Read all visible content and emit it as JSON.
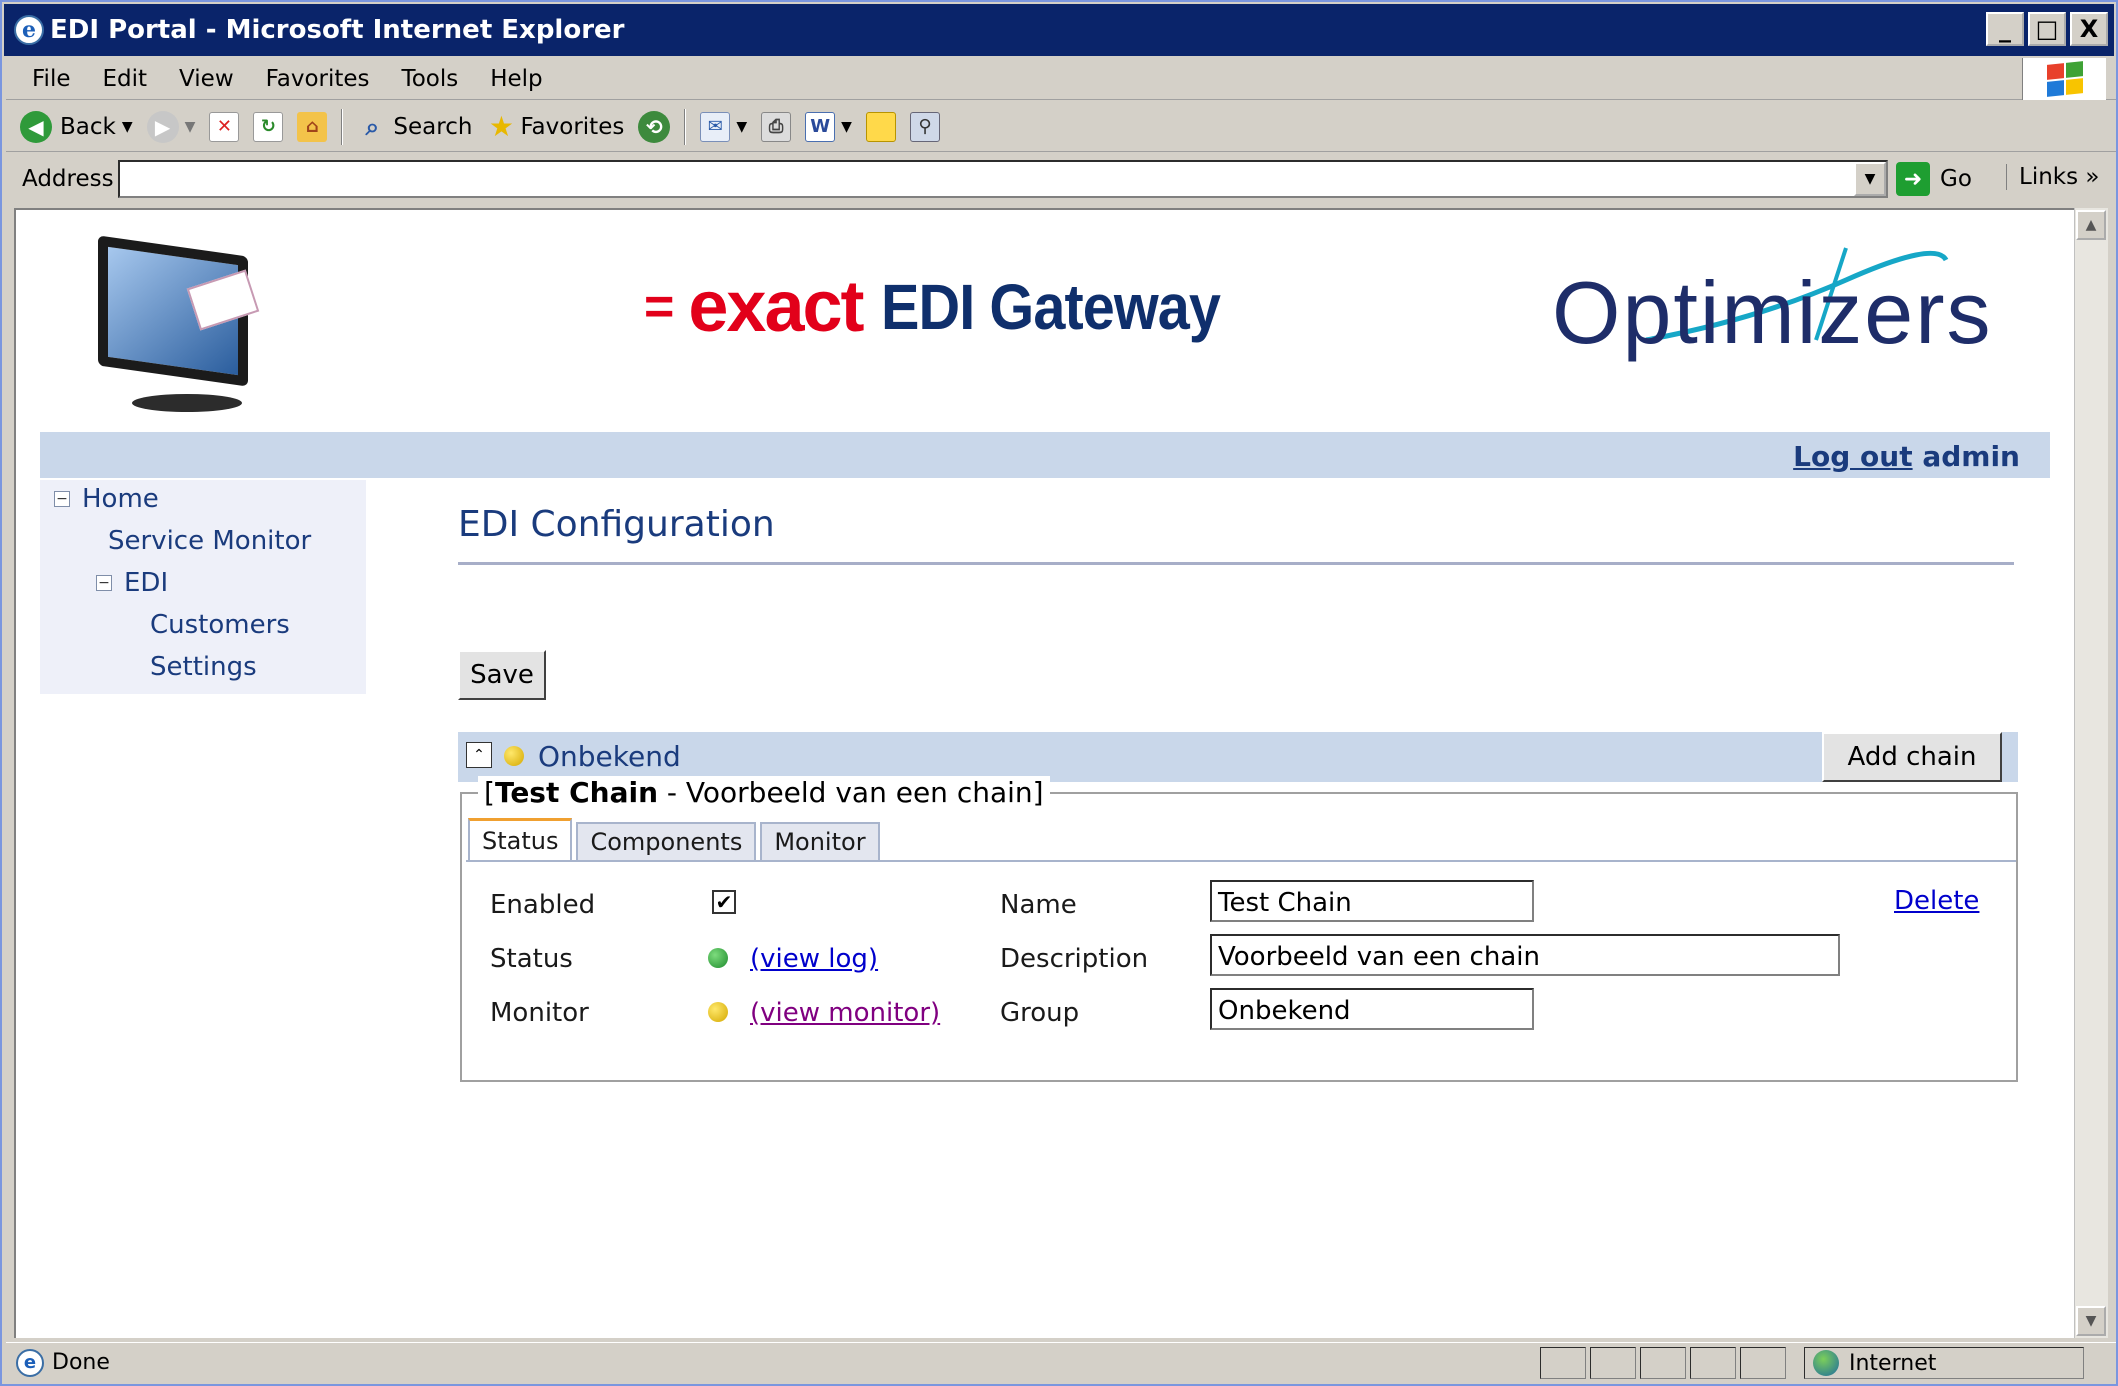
{
  "window": {
    "title": "EDI Portal - Microsoft Internet Explorer",
    "buttons": [
      "_",
      "□",
      "X"
    ]
  },
  "menu": [
    "File",
    "Edit",
    "View",
    "Favorites",
    "Tools",
    "Help"
  ],
  "toolbar": {
    "back_label": "Back",
    "search_label": "Search",
    "favorites_label": "Favorites"
  },
  "address": {
    "label": "Address",
    "value": "",
    "go_label": "Go",
    "links_label": "Links"
  },
  "page": {
    "logo_exact": "exact",
    "logo_equals": "=",
    "logo_gateway": "EDI Gateway",
    "logo_optimizers": "Optimizers",
    "logout_link": "Log out",
    "logout_user": "admin",
    "nav": {
      "home": "Home",
      "service_monitor": "Service Monitor",
      "edi": "EDI",
      "customers": "Customers",
      "settings": "Settings"
    },
    "heading": "EDI Configuration",
    "save_button": "Save",
    "group_name": "Onbekend",
    "add_chain_button": "Add chain",
    "chain_legend_open": "[",
    "chain_legend_name": "Test Chain",
    "chain_legend_rest": " - Voorbeeld van een chain]",
    "tabs": [
      "Status",
      "Components",
      "Monitor"
    ],
    "status_tab": {
      "enabled_label": "Enabled",
      "enabled_checked": "✔",
      "status_label": "Status",
      "status_link": "(view log)",
      "monitor_label": "Monitor",
      "monitor_link": "(view monitor)",
      "name_label": "Name",
      "name_value": "Test Chain",
      "description_label": "Description",
      "description_value": "Voorbeeld van een chain",
      "group_label": "Group",
      "group_value": "Onbekend",
      "delete_link": "Delete"
    }
  },
  "statusbar": {
    "status_text": "Done",
    "zone_text": "Internet"
  },
  "colors": {
    "title_bar": "#0a246a",
    "exact_red": "#e2001a",
    "brand_navy": "#1a3b7d",
    "band_blue": "#c9d7ea",
    "status_green": "#1d8a2c",
    "status_yellow": "#d4a800",
    "link_visited": "#800080",
    "link_unvisited": "#0000cc"
  },
  "icons": [
    "ie-icon",
    "windows-flag-icon",
    "back-arrow-icon",
    "forward-arrow-icon",
    "stop-icon",
    "refresh-icon",
    "home-icon",
    "search-icon",
    "favorites-star-icon",
    "history-icon",
    "mail-icon",
    "print-icon",
    "edit-icon",
    "discuss-icon",
    "research-icon",
    "go-arrow-icon",
    "globe-icon"
  ]
}
